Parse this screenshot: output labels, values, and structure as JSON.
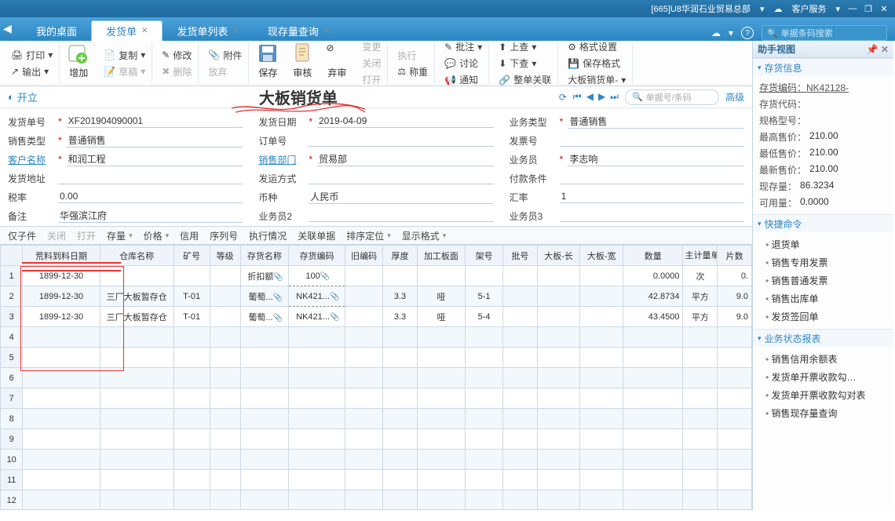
{
  "titlebar": {
    "company": "[665]U8华润石业贸易总部",
    "service": "客户服务",
    "dropdown_icon": "▾"
  },
  "tabs": {
    "items": [
      {
        "label": "我的桌面",
        "closable": false
      },
      {
        "label": "发货单",
        "closable": true,
        "active": true
      },
      {
        "label": "发货单列表",
        "closable": true
      },
      {
        "label": "现存量查询",
        "closable": true
      }
    ],
    "search_placeholder": "单据条码搜索"
  },
  "ribbon": {
    "print": "打印",
    "output": "输出",
    "add": "增加",
    "copy": "复制",
    "draft": "草稿",
    "modify": "修改",
    "delete": "删除",
    "attach": "附件",
    "release": "放弃",
    "save": "保存",
    "audit": "审核",
    "abandon": "弃审",
    "change": "变更",
    "close": "关闭",
    "open": "打开",
    "execute": "执行",
    "weigh": "称重",
    "approve": "批注",
    "discuss": "讨论",
    "notify": "通知",
    "topq": "上查",
    "botq": "下查",
    "whole": "整单关联",
    "format": "格式设置",
    "saveformat": "保存格式",
    "template": "大板销货单-"
  },
  "docbar": {
    "kai": "开立",
    "title": "大板销货单",
    "search_placeholder": "单据号/条码",
    "advanced": "高级"
  },
  "form": {
    "billno_label": "发货单号",
    "billno": "XF201904090001",
    "billdate_label": "发货日期",
    "billdate": "2019-04-09",
    "biztype_label": "业务类型",
    "biztype": "普通销售",
    "saletype_label": "销售类型",
    "saletype": "普通销售",
    "orderno_label": "订单号",
    "orderno": "",
    "invoice_label": "发票号",
    "invoice": "",
    "customer_label": "客户名称",
    "customer": "和润工程",
    "dept_label": "销售部门",
    "dept": "贸易部",
    "salesman_label": "业务员",
    "salesman": "李志响",
    "shipaddr_label": "发货地址",
    "shipaddr": "",
    "shipmode_label": "发运方式",
    "shipmode": "",
    "payterm_label": "付款条件",
    "payterm": "",
    "taxrate_label": "税率",
    "taxrate": "0.00",
    "currency_label": "币种",
    "currency": "人民币",
    "rate_label": "汇率",
    "rate": "1",
    "remark_label": "备注",
    "remark": "华强滨江府",
    "sales2_label": "业务员2",
    "sales2": "",
    "sales3_label": "业务员3",
    "sales3": ""
  },
  "gridbar": {
    "only": "仅子件",
    "closeg": "关闭",
    "openg": "打开",
    "stock": "存量",
    "price": "价格",
    "credit": "信用",
    "serial": "序列号",
    "exec": "执行情况",
    "related": "关联单据",
    "sort": "排序定位",
    "display": "显示格式"
  },
  "grid": {
    "headers": {
      "rawdate": "荒料到料日期",
      "warehouse": "仓库名称",
      "mine": "矿号",
      "grade": "等级",
      "invname": "存货名称",
      "invcode": "存货编码",
      "oldcode": "旧编码",
      "thick": "厚度",
      "surface": "加工板面",
      "shelf": "架号",
      "batch": "批号",
      "len": "大板-长",
      "wid": "大板-宽",
      "qty": "数量",
      "unit": "主计量单位",
      "amt": "片数"
    },
    "rows": [
      {
        "rawdate": "1899-12-30",
        "warehouse": "",
        "mine": "",
        "grade": "",
        "invname": "折扣额",
        "invcode": "100",
        "oldcode": "",
        "thick": "",
        "surface": "",
        "shelf": "",
        "batch": "",
        "len": "",
        "wid": "",
        "qty": "0.0000",
        "unit": "次",
        "amt": "0."
      },
      {
        "rawdate": "1899-12-30",
        "warehouse": "三厂大板暂存仓",
        "mine": "T-01",
        "grade": "",
        "invname": "葡萄...",
        "invcode": "NK421...",
        "oldcode": "",
        "thick": "3.3",
        "surface": "哑",
        "shelf": "5-1",
        "batch": "",
        "len": "",
        "wid": "",
        "qty": "42.8734",
        "unit": "平方",
        "amt": "9.0"
      },
      {
        "rawdate": "1899-12-30",
        "warehouse": "三厂大板暂存仓",
        "mine": "T-01",
        "grade": "",
        "invname": "葡萄...",
        "invcode": "NK421...",
        "oldcode": "",
        "thick": "3.3",
        "surface": "哑",
        "shelf": "5-4",
        "batch": "",
        "len": "",
        "wid": "",
        "qty": "43.4500",
        "unit": "平方",
        "amt": "9.0"
      }
    ],
    "empty_rows": 9
  },
  "rightpanel": {
    "title": "助手视图",
    "stockinfo": {
      "title": "存货信息",
      "invcode_label": "存货编码：",
      "invcode": "NK42128-",
      "invid_label": "存货代码：",
      "invid": "",
      "spec_label": "规格型号：",
      "spec": "",
      "maxprice_label": "最高售价：",
      "maxprice": "210.00",
      "minprice_label": "最低售价：",
      "minprice": "210.00",
      "latest_label": "最新售价：",
      "latest": "210.00",
      "onhand_label": "现存量：",
      "onhand": "86.3234",
      "avail_label": "可用量：",
      "avail": "0.0000"
    },
    "quickcmd": {
      "title": "快捷命令",
      "items": [
        "退货单",
        "销售专用发票",
        "销售普通发票",
        "销售出库单",
        "发货签回单"
      ]
    },
    "bizreport": {
      "title": "业务状态报表",
      "items": [
        "销售信用余额表",
        "发货单开票收款勾…",
        "发货单开票收款勾对表",
        "销售现存量查询"
      ]
    }
  }
}
